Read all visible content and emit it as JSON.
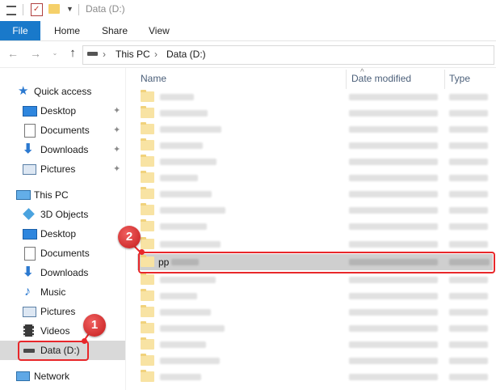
{
  "window": {
    "title": "Data (D:)"
  },
  "ribbon": {
    "tabs": [
      "File",
      "Home",
      "Share",
      "View"
    ],
    "accent": "#1979ca"
  },
  "address": {
    "crumbs": [
      "This PC",
      "Data (D:)"
    ],
    "separator": "›"
  },
  "nav_pane": {
    "quick_access": {
      "label": "Quick access",
      "items": [
        {
          "label": "Desktop",
          "icon": "desktop-icon",
          "pinned": true
        },
        {
          "label": "Documents",
          "icon": "documents-icon",
          "pinned": true
        },
        {
          "label": "Downloads",
          "icon": "downloads-icon",
          "pinned": true
        },
        {
          "label": "Pictures",
          "icon": "pictures-icon",
          "pinned": true
        }
      ]
    },
    "this_pc": {
      "label": "This PC",
      "items": [
        {
          "label": "3D Objects",
          "icon": "3d-objects-icon"
        },
        {
          "label": "Desktop",
          "icon": "desktop-icon"
        },
        {
          "label": "Documents",
          "icon": "documents-icon"
        },
        {
          "label": "Downloads",
          "icon": "downloads-icon"
        },
        {
          "label": "Music",
          "icon": "music-icon"
        },
        {
          "label": "Pictures",
          "icon": "pictures-icon"
        },
        {
          "label": "Videos",
          "icon": "videos-icon"
        },
        {
          "label": "Data (D:)",
          "icon": "drive-icon",
          "selected": true
        }
      ]
    },
    "network": {
      "label": "Network"
    }
  },
  "file_list": {
    "columns": [
      "Name",
      "Date modified",
      "Type"
    ],
    "selected_item_visible_name": "pp",
    "annotation_color": "#e8272a"
  },
  "annotations": [
    {
      "number": "1",
      "target": "Data (D:)"
    },
    {
      "number": "2",
      "target": "pp"
    }
  ]
}
